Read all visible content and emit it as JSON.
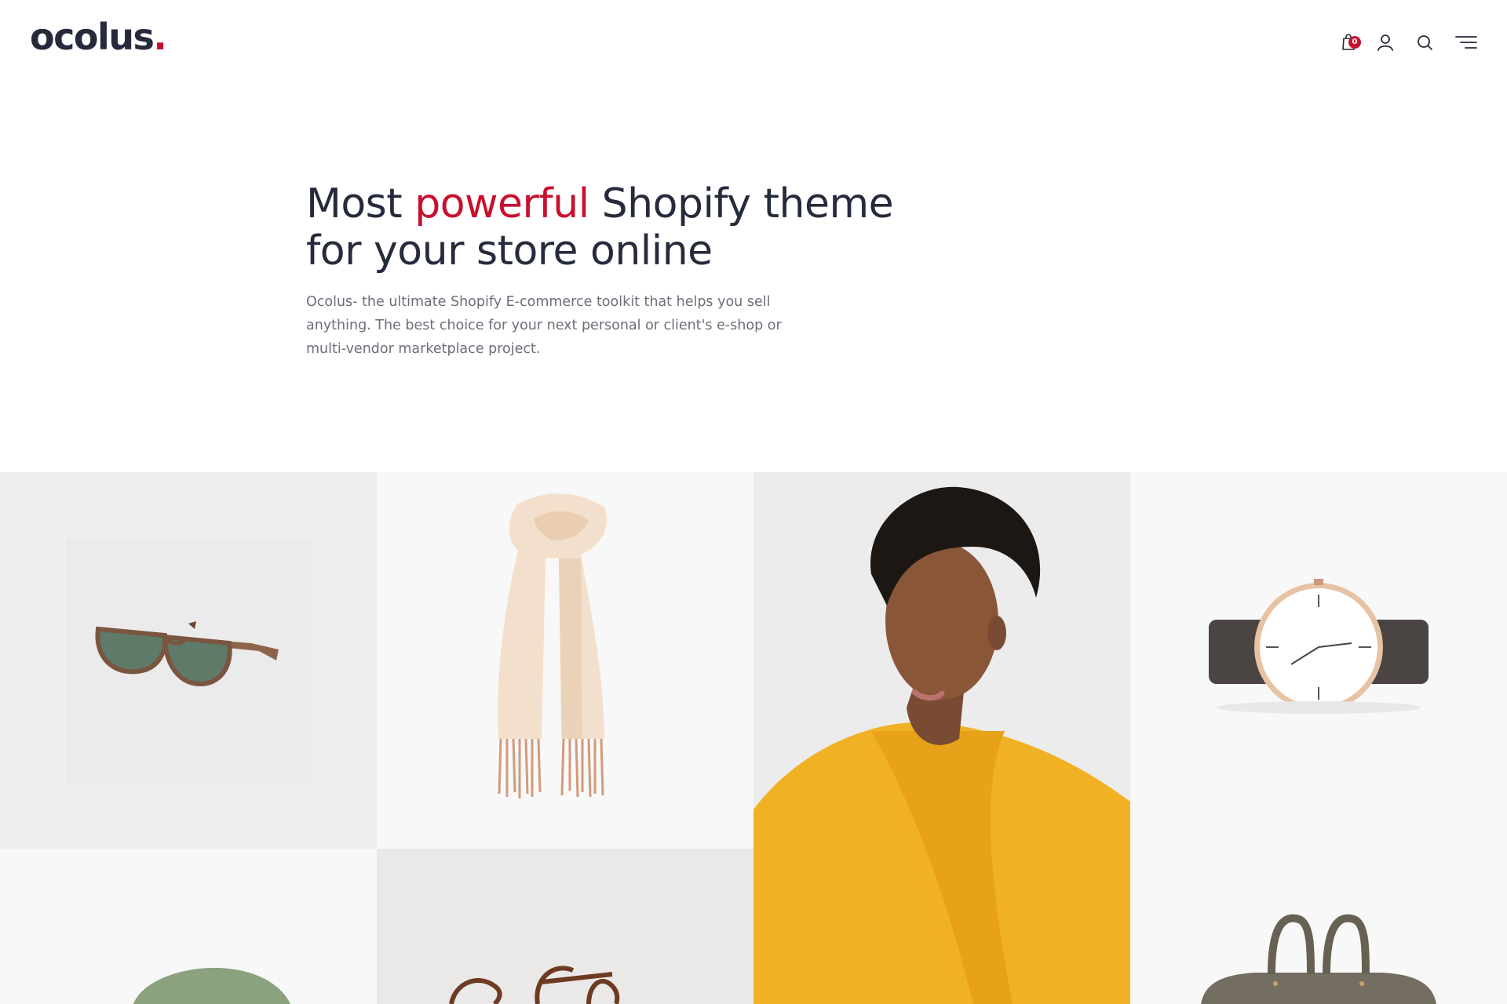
{
  "header": {
    "logo_text": "ocolus",
    "logo_dot": ".",
    "cart_count": "0",
    "icons": [
      "shopping-bag-icon",
      "user-icon",
      "search-icon",
      "menu-icon"
    ]
  },
  "hero": {
    "title_before": "Most ",
    "title_accent": "powerful",
    "title_after": " Shopify theme",
    "title_line2": "for your store online",
    "description": "Ocolus- the ultimate Shopify E-commerce toolkit that helps you sell anything. The best choice for your next personal or client's e-shop or multi-vendor marketplace project."
  },
  "colors": {
    "brand_dark": "#252b3b",
    "accent_red": "#c8102e",
    "muted_text": "#6b6f78"
  },
  "products": [
    {
      "name": "sunglasses"
    },
    {
      "name": "scarf"
    },
    {
      "name": "model-yellow-top"
    },
    {
      "name": "wristwatch"
    },
    {
      "name": "cap"
    },
    {
      "name": "sandals"
    },
    {
      "name": "duffel-bag"
    }
  ]
}
